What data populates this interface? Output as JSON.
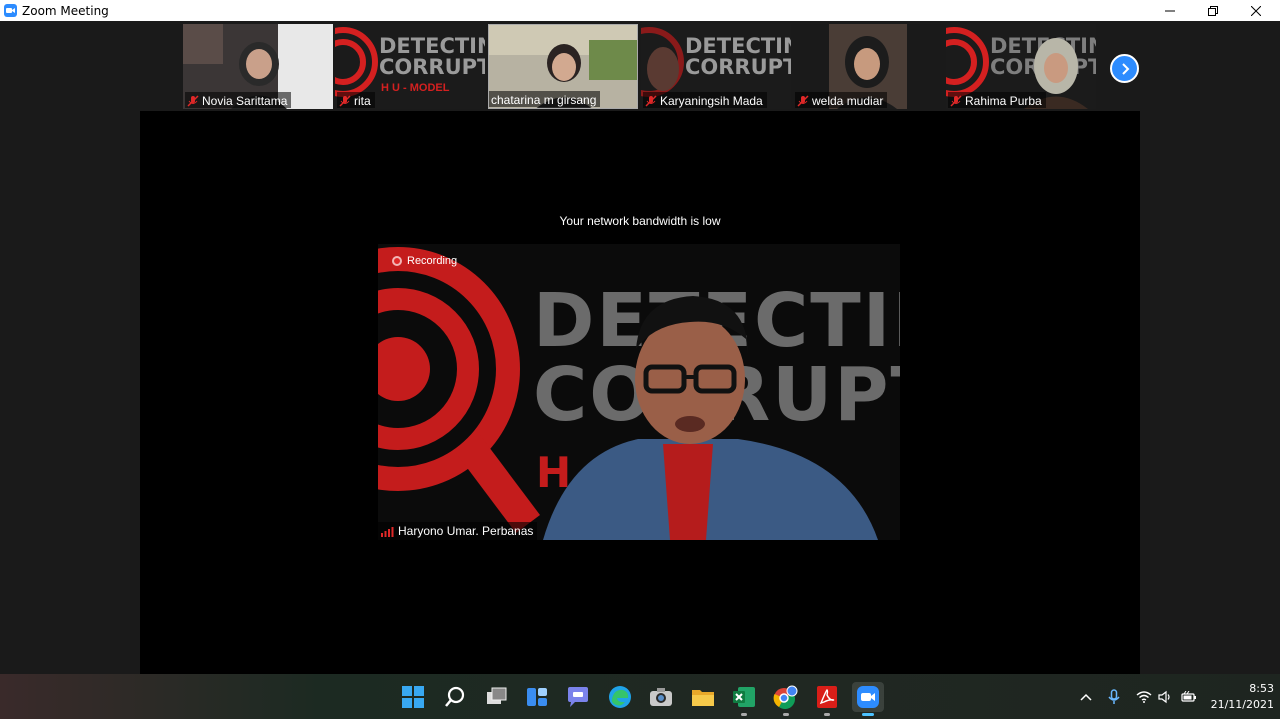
{
  "window": {
    "title": "Zoom Meeting"
  },
  "participants": [
    {
      "name": "Novia Sarittama"
    },
    {
      "name": "rita"
    },
    {
      "name": "chatarina m girsang"
    },
    {
      "name": "Karyaningsih Mada"
    },
    {
      "name": "welda mudiar"
    },
    {
      "name": "Rahima Purba"
    }
  ],
  "banner": {
    "line1": "DETECTIN",
    "line2": "CORRUPT",
    "line3": "H U - MODEL"
  },
  "stage": {
    "notice": "Your network bandwidth is low",
    "recording_label": "Recording",
    "speaker_name": "Haryono Umar. Perbanas"
  },
  "taskbar": {
    "apps": [
      "windows-start",
      "search",
      "task-view",
      "widgets",
      "teams-chat",
      "edge",
      "camera",
      "file-explorer",
      "excel",
      "chrome",
      "acrobat",
      "zoom"
    ],
    "time": "8:53",
    "date": "21/11/2021"
  },
  "colors": {
    "zoom_blue": "#2d8cff",
    "mute_red": "#e02828",
    "banner_red": "#d42020"
  }
}
